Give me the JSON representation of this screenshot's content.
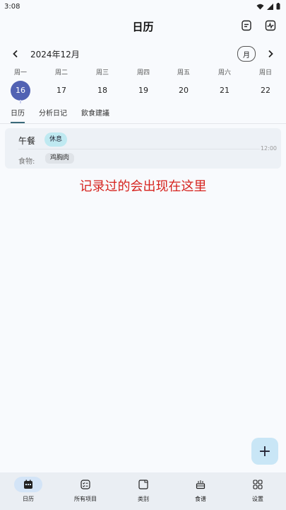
{
  "status_bar": {
    "time": "3:08"
  },
  "app_bar": {
    "title": "日历"
  },
  "month_row": {
    "month_label": "2024年12月",
    "view_toggle": "月"
  },
  "week": [
    {
      "weekday": "周一",
      "day": "16",
      "selected": true
    },
    {
      "weekday": "周二",
      "day": "17"
    },
    {
      "weekday": "周三",
      "day": "18"
    },
    {
      "weekday": "周四",
      "day": "19"
    },
    {
      "weekday": "周五",
      "day": "20"
    },
    {
      "weekday": "周六",
      "day": "21"
    },
    {
      "weekday": "周日",
      "day": "22"
    }
  ],
  "tabs": [
    {
      "label": "日历",
      "active": true
    },
    {
      "label": "分析日记"
    },
    {
      "label": "飲食建議"
    }
  ],
  "meal_card": {
    "title": "午餐",
    "badge": "休息",
    "time": "12:00",
    "food_label": "食物:",
    "food_chip": "鸡胸肉"
  },
  "annotation": "记录过的会出现在这里",
  "fab": {
    "icon": "plus-icon",
    "label": "+"
  },
  "bottom_nav": [
    {
      "label": "日历",
      "icon": "calendar-icon",
      "active": true
    },
    {
      "label": "所有项目",
      "icon": "list-icon"
    },
    {
      "label": "类别",
      "icon": "category-icon"
    },
    {
      "label": "食谱",
      "icon": "recipe-icon"
    },
    {
      "label": "设置",
      "icon": "settings-grid-icon"
    }
  ],
  "colors": {
    "accent": "#5162b3",
    "badge_bg": "#bfe9f1",
    "annotation": "#d6231e",
    "fab_bg": "#c9e6f6",
    "nav_bg": "#eaeef3"
  }
}
